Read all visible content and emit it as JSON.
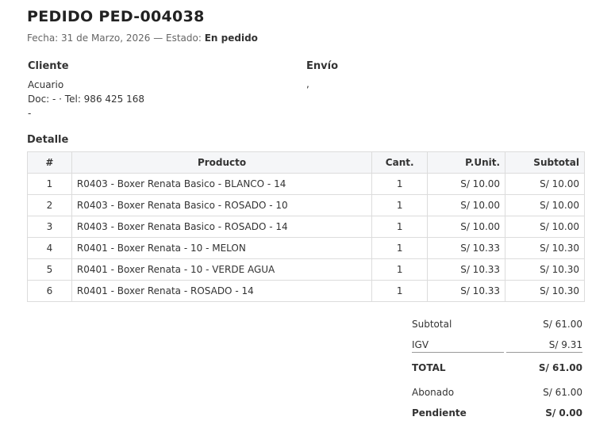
{
  "header": {
    "title": "PEDIDO PED-004038",
    "fecha_prefix": "Fecha: 31 de Marzo, 2026 — Estado: ",
    "estado": "En pedido"
  },
  "cliente": {
    "heading": "Cliente",
    "name": "Acuario",
    "doc_line": "Doc: - · Tel: 986 425 168",
    "extra": "-"
  },
  "envio": {
    "heading": "Envío",
    "line": ","
  },
  "detalle": {
    "heading": "Detalle",
    "columns": [
      "#",
      "Producto",
      "Cant.",
      "P.Unit.",
      "Subtotal"
    ],
    "rows": [
      {
        "n": "1",
        "producto": "R0403 - Boxer Renata Basico - BLANCO - 14",
        "cant": "1",
        "punit": "S/ 10.00",
        "subtotal": "S/ 10.00"
      },
      {
        "n": "2",
        "producto": "R0403 - Boxer Renata Basico - ROSADO - 10",
        "cant": "1",
        "punit": "S/ 10.00",
        "subtotal": "S/ 10.00"
      },
      {
        "n": "3",
        "producto": "R0403 - Boxer Renata Basico - ROSADO - 14",
        "cant": "1",
        "punit": "S/ 10.00",
        "subtotal": "S/ 10.00"
      },
      {
        "n": "4",
        "producto": "R0401 - Boxer Renata - 10 - MELON",
        "cant": "1",
        "punit": "S/ 10.33",
        "subtotal": "S/ 10.30"
      },
      {
        "n": "5",
        "producto": "R0401 - Boxer Renata - 10 - VERDE AGUA",
        "cant": "1",
        "punit": "S/ 10.33",
        "subtotal": "S/ 10.30"
      },
      {
        "n": "6",
        "producto": "R0401 - Boxer Renata - ROSADO - 14",
        "cant": "1",
        "punit": "S/ 10.33",
        "subtotal": "S/ 10.30"
      }
    ]
  },
  "totals": {
    "subtotal_label": "Subtotal",
    "subtotal_value": "S/ 61.00",
    "igv_label": "IGV",
    "igv_value": "S/ 9.31",
    "total_label": "TOTAL",
    "total_value": "S/ 61.00",
    "abonado_label": "Abonado",
    "abonado_value": "S/ 61.00",
    "pendiente_label": "Pendiente",
    "pendiente_value": "S/ 0.00"
  }
}
